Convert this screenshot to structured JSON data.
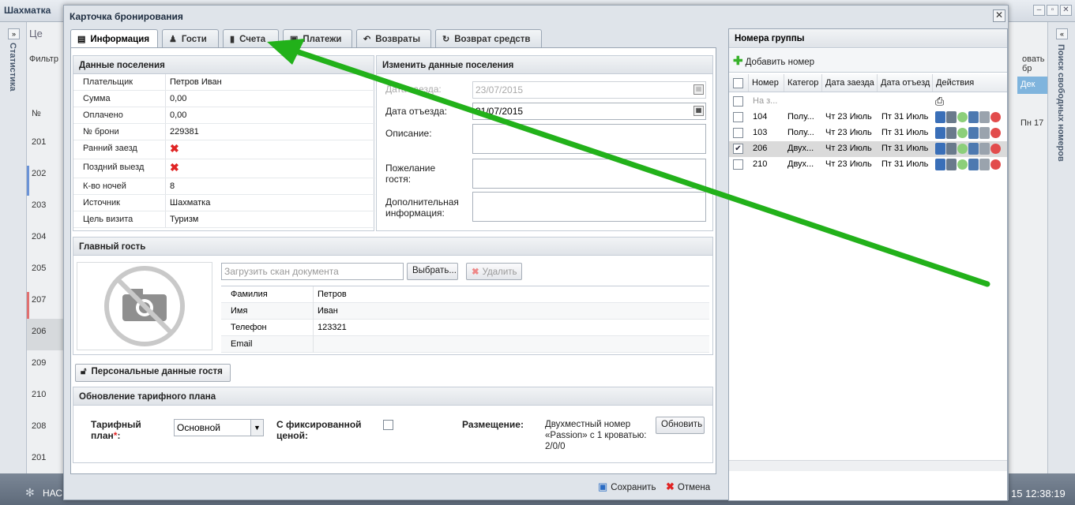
{
  "bg": {
    "title": "Шахматка",
    "left_vertical": "Статистика",
    "right_vertical": "Поиск свободных номеров",
    "rows": [
      "№",
      "201",
      "202",
      "203",
      "204",
      "205",
      "207",
      "206",
      "209",
      "210",
      "208",
      "201"
    ],
    "right_fragment_1": "овать бр",
    "right_fragment_2": "Дек",
    "right_fragment_3": "Пн 17",
    "clock": "15 12:38:19",
    "bottom_left": "НАС",
    "top_fragment": "Це",
    "filter_fragment": "Фильтр"
  },
  "modal": {
    "title": "Карточка бронирования",
    "close_glyph": "✕",
    "tabs": [
      {
        "label": "Информация",
        "icon": "briefcase-icon"
      },
      {
        "label": "Гости",
        "icon": "users-icon"
      },
      {
        "label": "Счета",
        "icon": "document-icon"
      },
      {
        "label": "Платежи",
        "icon": "money-icon"
      },
      {
        "label": "Возвраты",
        "icon": "back-arrow-icon"
      },
      {
        "label": "Возврат средств",
        "icon": "refresh-icon"
      }
    ],
    "stay": {
      "title": "Данные поселения",
      "rows": [
        {
          "k": "Плательщик",
          "v": "Петров Иван"
        },
        {
          "k": "Сумма",
          "v": "0,00"
        },
        {
          "k": "Оплачено",
          "v": "0,00"
        },
        {
          "k": "№ брони",
          "v": "229381"
        },
        {
          "k": "Ранний заезд",
          "v": "✖"
        },
        {
          "k": "Поздний выезд",
          "v": "✖"
        },
        {
          "k": "К-во ночей",
          "v": "8"
        },
        {
          "k": "Источник",
          "v": "Шахматка"
        },
        {
          "k": "Цель визита",
          "v": "Туризм"
        }
      ]
    },
    "edit": {
      "title": "Изменить данные поселения",
      "checkin_label": "Дата заезда:",
      "checkin_value": "23/07/2015",
      "checkout_label": "Дата отъезда:",
      "checkout_value": "31/07/2015",
      "description_label": "Описание:",
      "wish_label": "Пожелание гостя:",
      "extra_label": "Дополнительная информация:"
    },
    "guest": {
      "title": "Главный гость",
      "scan_placeholder": "Загрузить скан документа",
      "choose_btn": "Выбрать...",
      "delete_btn": "Удалить",
      "rows": [
        {
          "k": "Фамилия",
          "v": "Петров"
        },
        {
          "k": "Имя",
          "v": "Иван"
        },
        {
          "k": "Телефон",
          "v": "123321"
        },
        {
          "k": "Email",
          "v": ""
        }
      ],
      "personal_btn": "Персональные данные гостя"
    },
    "tariff": {
      "title": "Обновление тарифного плана",
      "plan_label": "Тарифный план",
      "plan_required": "*",
      "plan_colon": ":",
      "plan_value": "Основной",
      "fixed_label": "С фиксированной ценой:",
      "placement_label": "Размещение:",
      "placement_value": "Двухместный номер «Passion» с 1 кроватью: 2/0/0",
      "update_btn": "Обновить"
    },
    "footer": {
      "save": "Сохранить",
      "cancel": "Отмена"
    },
    "group": {
      "title": "Номера группы",
      "add_btn": "Добавить номер",
      "headers": [
        "Номер",
        "Категор",
        "Дата заезда",
        "Дата отъезд",
        "Действия"
      ],
      "rows": [
        {
          "num": "На з...",
          "cat": "",
          "in": "",
          "out": "",
          "checked": false,
          "print": true
        },
        {
          "num": "104",
          "cat": "Полу...",
          "in": "Чт 23 Июль",
          "out": "Пт 31 Июль",
          "checked": false,
          "print": false
        },
        {
          "num": "103",
          "cat": "Полу...",
          "in": "Чт 23 Июль",
          "out": "Пт 31 Июль",
          "checked": false,
          "print": false
        },
        {
          "num": "206",
          "cat": "Двух...",
          "in": "Чт 23 Июль",
          "out": "Пт 31 Июль",
          "checked": true,
          "print": false
        },
        {
          "num": "210",
          "cat": "Двух...",
          "in": "Чт 23 Июль",
          "out": "Пт 31 Июль",
          "checked": false,
          "print": false
        }
      ]
    }
  },
  "colors": {
    "arrow": "#22b11a",
    "accent": "#2c3e55",
    "error": "#e02424"
  }
}
